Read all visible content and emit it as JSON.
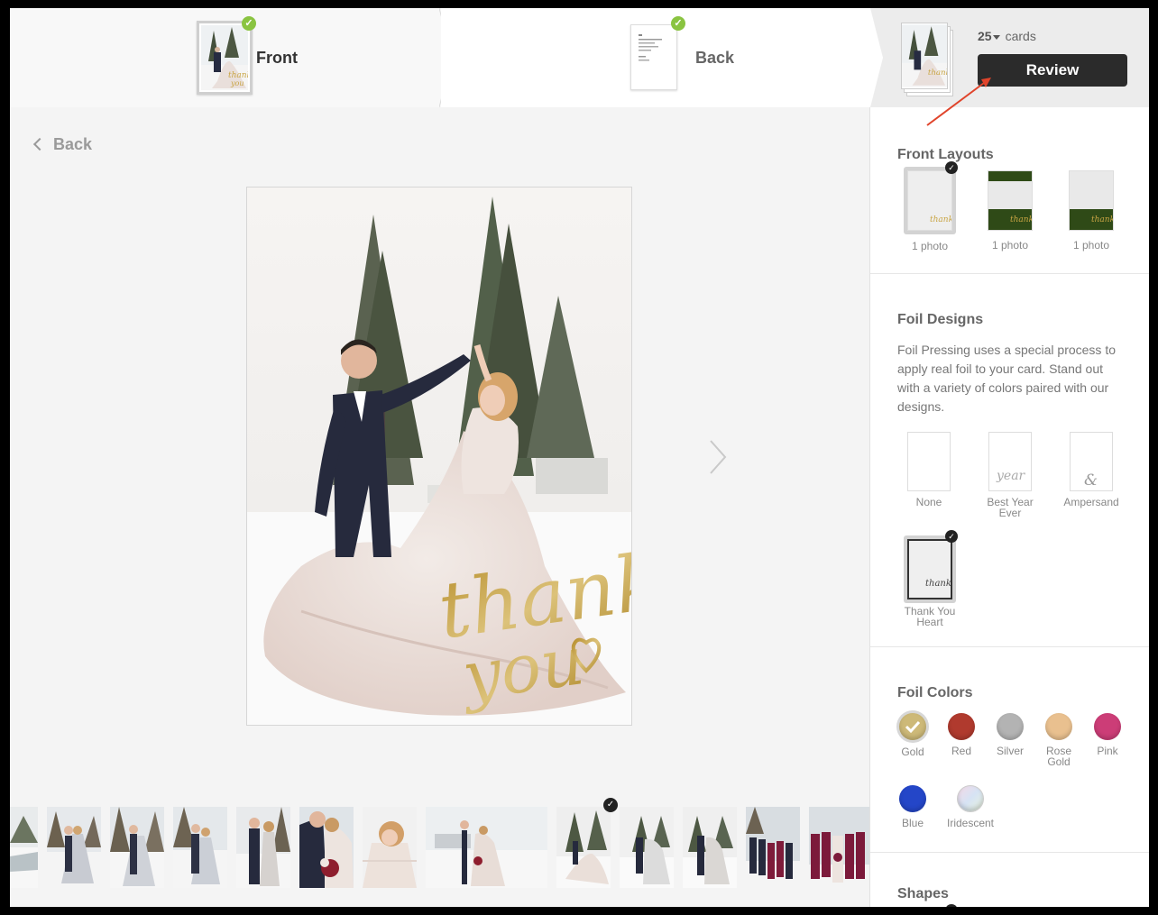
{
  "steps": {
    "front_label": "Front",
    "back_label": "Back"
  },
  "order": {
    "quantity": "25",
    "unit": "cards",
    "review_label": "Review"
  },
  "canvas": {
    "back_link": "Back",
    "card_script_line1": "thank",
    "card_script_line2": "you"
  },
  "panel": {
    "front_layouts": {
      "title": "Front Layouts",
      "items": [
        {
          "label": "1 photo",
          "selected": true
        },
        {
          "label": "1 photo",
          "selected": false
        },
        {
          "label": "1 photo",
          "selected": false
        }
      ]
    },
    "foil_designs": {
      "title": "Foil Designs",
      "description": "Foil Pressing uses a special process to apply real foil to your card. Stand out with a variety of colors paired with our designs.",
      "items": [
        {
          "label": "None",
          "art": "",
          "selected": false
        },
        {
          "label": "Best Year Ever",
          "art": "year",
          "selected": false
        },
        {
          "label": "Ampersand",
          "art": "&",
          "selected": false
        },
        {
          "label": "Thank You Heart",
          "art": "thank you",
          "selected": true
        }
      ]
    },
    "foil_colors": {
      "title": "Foil Colors",
      "items": [
        {
          "label": "Gold",
          "color": "#cdb978",
          "selected": true
        },
        {
          "label": "Red",
          "color": "#b03a2e",
          "selected": false
        },
        {
          "label": "Silver",
          "color": "#b3b3b3",
          "selected": false
        },
        {
          "label": "Rose Gold",
          "color": "#e9c08f",
          "selected": false
        },
        {
          "label": "Pink",
          "color": "#cc3d77",
          "selected": false
        },
        {
          "label": "Blue",
          "color": "#2446c8",
          "selected": false
        },
        {
          "label": "Iridescent",
          "color": "#d9dde6",
          "selected": false
        }
      ]
    },
    "shapes": {
      "title": "Shapes"
    }
  },
  "colors": {
    "accent_dark": "#2b2b2b",
    "step_check": "#8ac441",
    "layout_green": "#2f4a17",
    "foil_gold": "#c9a544",
    "annotation_red": "#e0442b"
  }
}
